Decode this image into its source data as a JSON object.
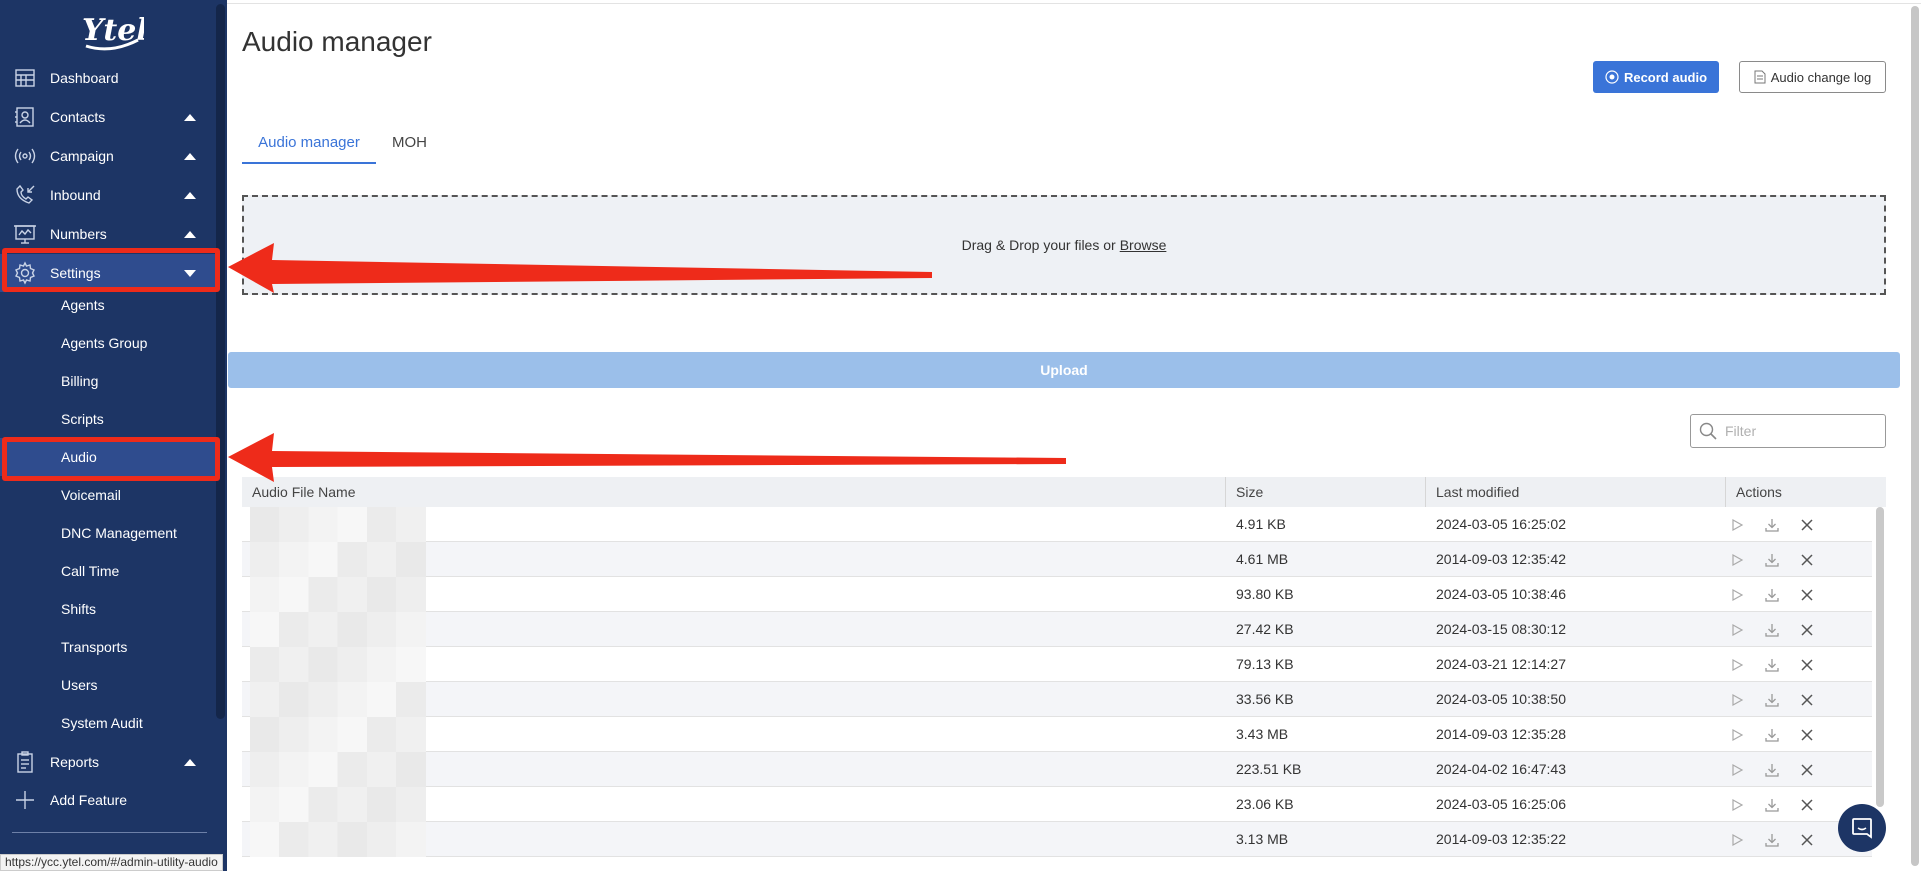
{
  "sidebar": {
    "logo_text": "Ytel",
    "items": [
      {
        "label": "Dashboard",
        "icon": "dashboard-icon",
        "caret": "none"
      },
      {
        "label": "Contacts",
        "icon": "contacts-icon",
        "caret": "up"
      },
      {
        "label": "Campaign",
        "icon": "campaign-icon",
        "caret": "up"
      },
      {
        "label": "Inbound",
        "icon": "inbound-icon",
        "caret": "up"
      },
      {
        "label": "Numbers",
        "icon": "numbers-icon",
        "caret": "up"
      },
      {
        "label": "Settings",
        "icon": "gear-icon",
        "caret": "down"
      }
    ],
    "settings_subitems": [
      {
        "label": "Agents"
      },
      {
        "label": "Agents Group"
      },
      {
        "label": "Billing"
      },
      {
        "label": "Scripts"
      },
      {
        "label": "Audio"
      },
      {
        "label": "Voicemail"
      },
      {
        "label": "DNC Management"
      },
      {
        "label": "Call Time"
      },
      {
        "label": "Shifts"
      },
      {
        "label": "Transports"
      },
      {
        "label": "Users"
      },
      {
        "label": "System Audit"
      }
    ],
    "bottom_items": [
      {
        "label": "Reports",
        "icon": "reports-icon",
        "caret": "up"
      },
      {
        "label": "Add Feature",
        "icon": "plus-icon",
        "caret": "none"
      }
    ],
    "active_item": "Settings",
    "active_subitem": "Audio"
  },
  "status_url": "https://ycc.ytel.com/#/admin-utility-audio",
  "page": {
    "title": "Audio manager",
    "record_button": "Record audio",
    "changelog_button": "Audio change log",
    "tabs": [
      {
        "label": "Audio manager",
        "active": true
      },
      {
        "label": "MOH",
        "active": false
      }
    ],
    "dropzone_text": "Drag & Drop your files or",
    "dropzone_link": "Browse",
    "upload_button": "Upload",
    "filter_placeholder": "Filter"
  },
  "table": {
    "columns": [
      "Audio File Name",
      "Size",
      "Last modified",
      "Actions"
    ],
    "rows": [
      {
        "size": "4.91 KB",
        "modified": "2024-03-05 16:25:02"
      },
      {
        "size": "4.61 MB",
        "modified": "2014-09-03 12:35:42"
      },
      {
        "size": "93.80 KB",
        "modified": "2024-03-05 10:38:46"
      },
      {
        "size": "27.42 KB",
        "modified": "2024-03-15 08:30:12"
      },
      {
        "size": "79.13 KB",
        "modified": "2024-03-21 12:14:27"
      },
      {
        "size": "33.56 KB",
        "modified": "2024-03-05 10:38:50"
      },
      {
        "size": "3.43 MB",
        "modified": "2014-09-03 12:35:28"
      },
      {
        "size": "223.51 KB",
        "modified": "2024-04-02 16:47:43"
      },
      {
        "size": "23.06 KB",
        "modified": "2024-03-05 16:25:06"
      },
      {
        "size": "3.13 MB",
        "modified": "2014-09-03 12:35:22"
      }
    ]
  },
  "colors": {
    "sidebar_bg": "#1d3565",
    "active_item_bg": "#2f4c8e",
    "accent": "#3a74d8",
    "highlight_red": "#ee2b1a"
  }
}
